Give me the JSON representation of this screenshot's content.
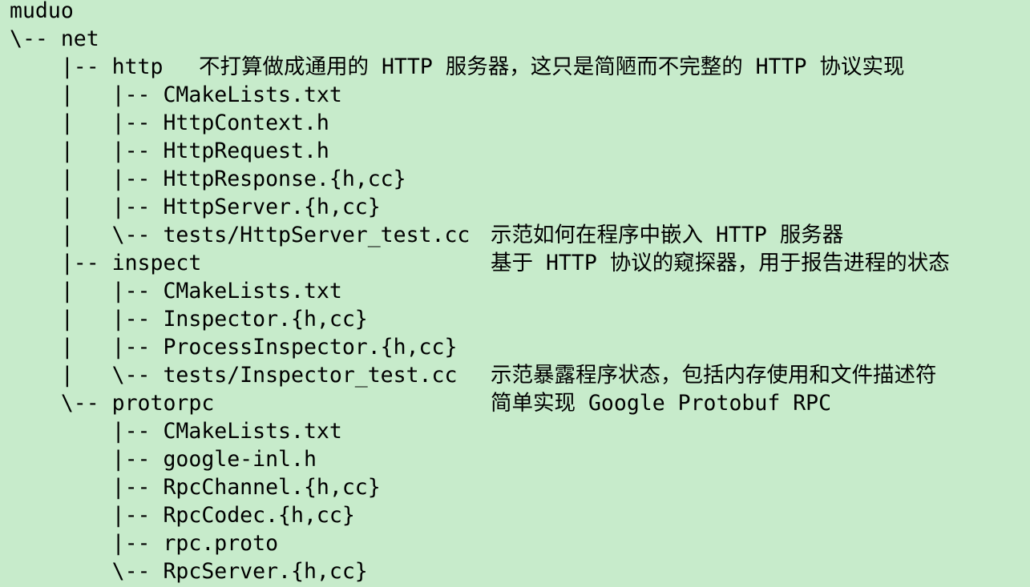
{
  "background_color": "#c7ebcb",
  "text_color": "#000000",
  "lines": [
    {
      "tree": "muduo",
      "comment": ""
    },
    {
      "tree": "\\-- net",
      "comment": ""
    },
    {
      "tree": "    |-- http   ",
      "comment": "不打算做成通用的 HTTP 服务器，这只是简陋而不完整的 HTTP 协议实现"
    },
    {
      "tree": "    |   |-- CMakeLists.txt",
      "comment": ""
    },
    {
      "tree": "    |   |-- HttpContext.h",
      "comment": ""
    },
    {
      "tree": "    |   |-- HttpRequest.h",
      "comment": ""
    },
    {
      "tree": "    |   |-- HttpResponse.{h,cc}",
      "comment": ""
    },
    {
      "tree": "    |   |-- HttpServer.{h,cc}",
      "comment": ""
    },
    {
      "tree": "    |   \\-- tests/HttpServer_test.cc",
      "comment": "示范如何在程序中嵌入 HTTP 服务器"
    },
    {
      "tree": "    |-- inspect",
      "comment": "基于 HTTP 协议的窥探器，用于报告进程的状态"
    },
    {
      "tree": "    |   |-- CMakeLists.txt",
      "comment": ""
    },
    {
      "tree": "    |   |-- Inspector.{h,cc}",
      "comment": ""
    },
    {
      "tree": "    |   |-- ProcessInspector.{h,cc}",
      "comment": ""
    },
    {
      "tree": "    |   \\-- tests/Inspector_test.cc",
      "comment": "示范暴露程序状态，包括内存使用和文件描述符"
    },
    {
      "tree": "    \\-- protorpc",
      "comment": "简单实现 Google Protobuf RPC"
    },
    {
      "tree": "        |-- CMakeLists.txt",
      "comment": ""
    },
    {
      "tree": "        |-- google-inl.h",
      "comment": ""
    },
    {
      "tree": "        |-- RpcChannel.{h,cc}",
      "comment": ""
    },
    {
      "tree": "        |-- RpcCodec.{h,cc}",
      "comment": ""
    },
    {
      "tree": "        |-- rpc.proto",
      "comment": ""
    },
    {
      "tree": "        \\-- RpcServer.{h,cc}",
      "comment": ""
    }
  ]
}
